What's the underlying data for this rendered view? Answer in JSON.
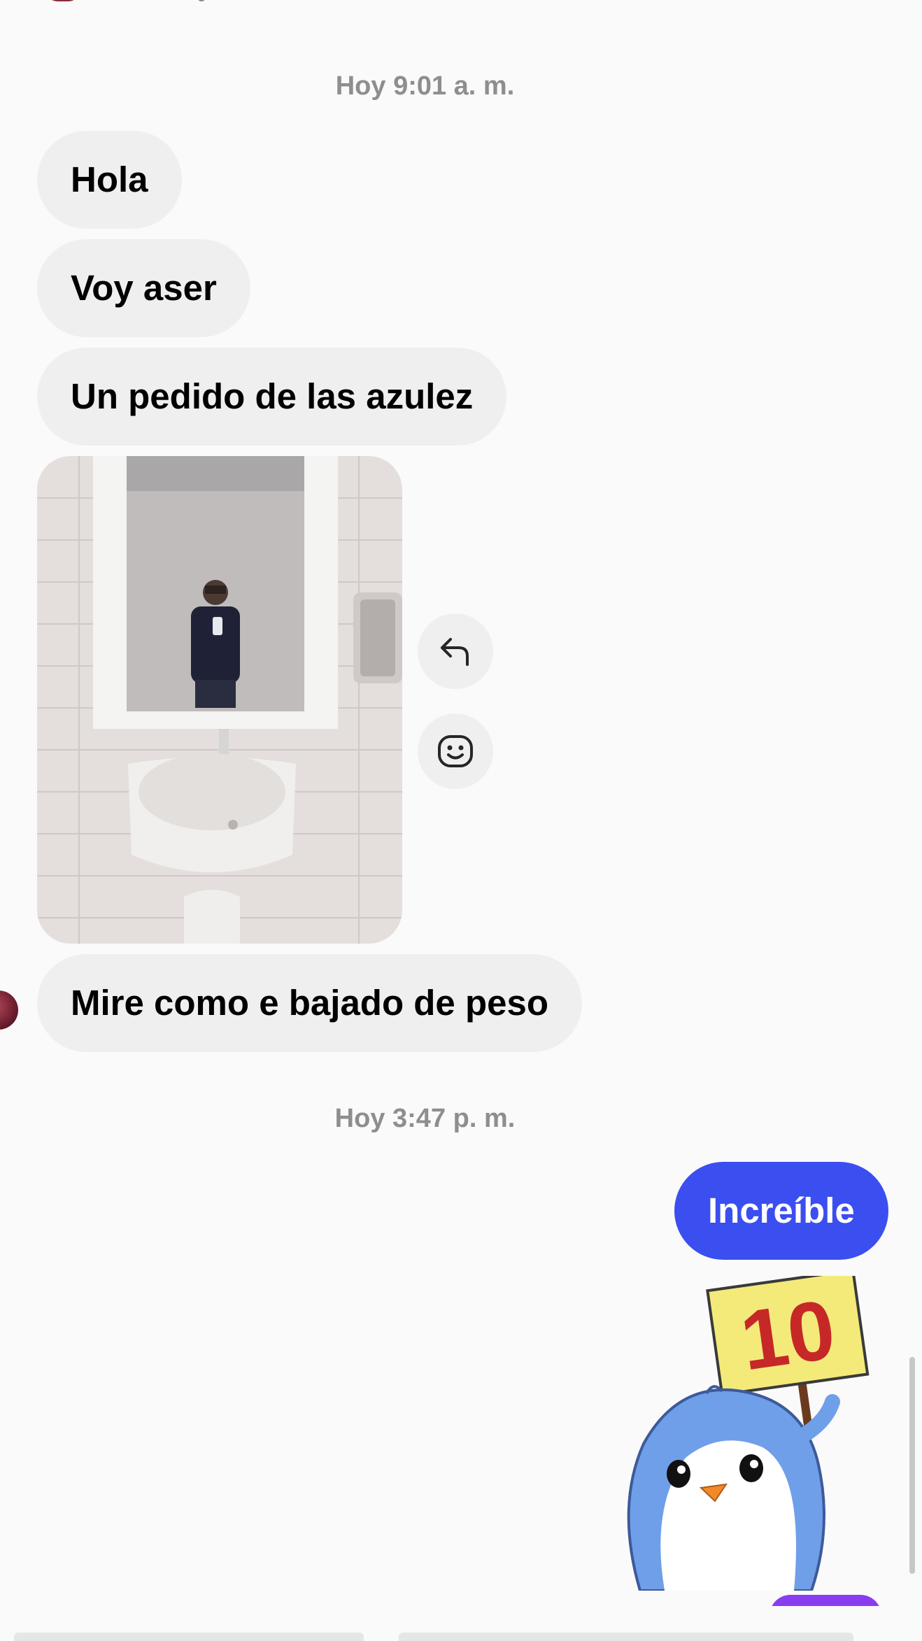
{
  "conversation": {
    "timestamps": {
      "morning": "Hoy 9:01 a. m.",
      "afternoon": "Hoy 3:47 p. m."
    },
    "incoming": [
      {
        "text": "Hola"
      },
      {
        "text": "Voy aser"
      },
      {
        "text": "Un pedido de las azulez"
      },
      {
        "text": "Mire como e bajado de peso"
      }
    ],
    "outgoing": [
      {
        "text": "Increíble"
      }
    ],
    "sticker": {
      "sign_text": "10"
    }
  },
  "icons": {
    "reply": "reply-arrow-icon",
    "react": "emoji-face-icon"
  },
  "colors": {
    "outgoing_bubble": "#3b4ef0",
    "incoming_bubble": "#efefef",
    "timestamp_text": "#8e8e8e",
    "background": "#fafafa"
  }
}
